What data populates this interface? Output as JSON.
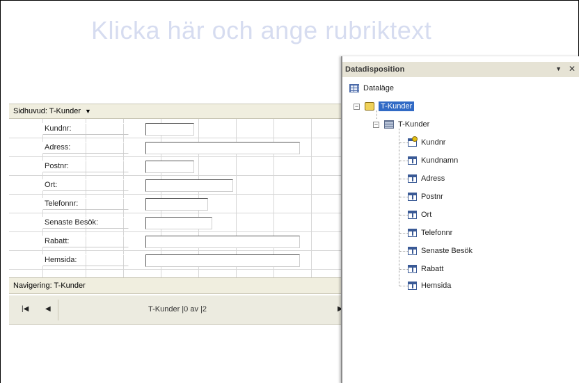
{
  "page": {
    "title_placeholder": "Klicka här och ange rubriktext"
  },
  "section": {
    "header_label": "Sidhuvud: T-Kunder",
    "dropdown_icon": "triangle-down-icon"
  },
  "form": {
    "fields": [
      {
        "label": "Kundnr:"
      },
      {
        "label": "Adress:"
      },
      {
        "label": "Postnr:"
      },
      {
        "label": "Ort:"
      },
      {
        "label": "Telefonnr:"
      },
      {
        "label": "Senaste Besök:"
      },
      {
        "label": "Rabatt:"
      },
      {
        "label": "Hemsida:"
      }
    ]
  },
  "navigation": {
    "header_label": "Navigering: T-Kunder",
    "first_icon": "first-record-icon",
    "prev_icon": "previous-record-icon",
    "next_icon": "next-record-icon",
    "status_text": "T-Kunder |0 av |2"
  },
  "data_panel": {
    "title": "Datadisposition",
    "menu_icon": "chevron-down-icon",
    "close_icon": "close-icon",
    "tree": {
      "root_label": "Dataläge",
      "db_label": "T-Kunder",
      "table_label": "T-Kunder",
      "fields": [
        "Kundnr",
        "Kundnamn",
        "Adress",
        "Postnr",
        "Ort",
        "Telefonnr",
        "Senaste Besök",
        "Rabatt",
        "Hemsida"
      ]
    },
    "accent_color": "#316ac5"
  }
}
